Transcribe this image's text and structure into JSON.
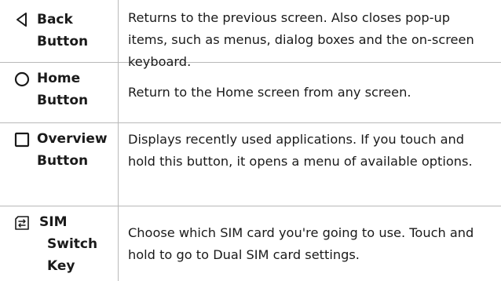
{
  "rows": [
    {
      "icon": "back-triangle-icon",
      "name": "Back\nButton",
      "description": "Returns to the previous screen. Also closes pop-up items, such as menus, dialog boxes and the on-screen keyboard."
    },
    {
      "icon": "home-circle-icon",
      "name": "Home\nButton",
      "description": "Return to the Home screen from any screen."
    },
    {
      "icon": "overview-square-icon",
      "name": "Overview\nButton",
      "description": "Displays recently used applications. If you touch and hold this button, it opens a menu of available options."
    },
    {
      "icon": "sim-switch-icon",
      "name": "SIM\nSwitch\nKey",
      "description": "Choose which SIM card you're going to use. Touch and hold to go to Dual SIM card settings."
    }
  ]
}
